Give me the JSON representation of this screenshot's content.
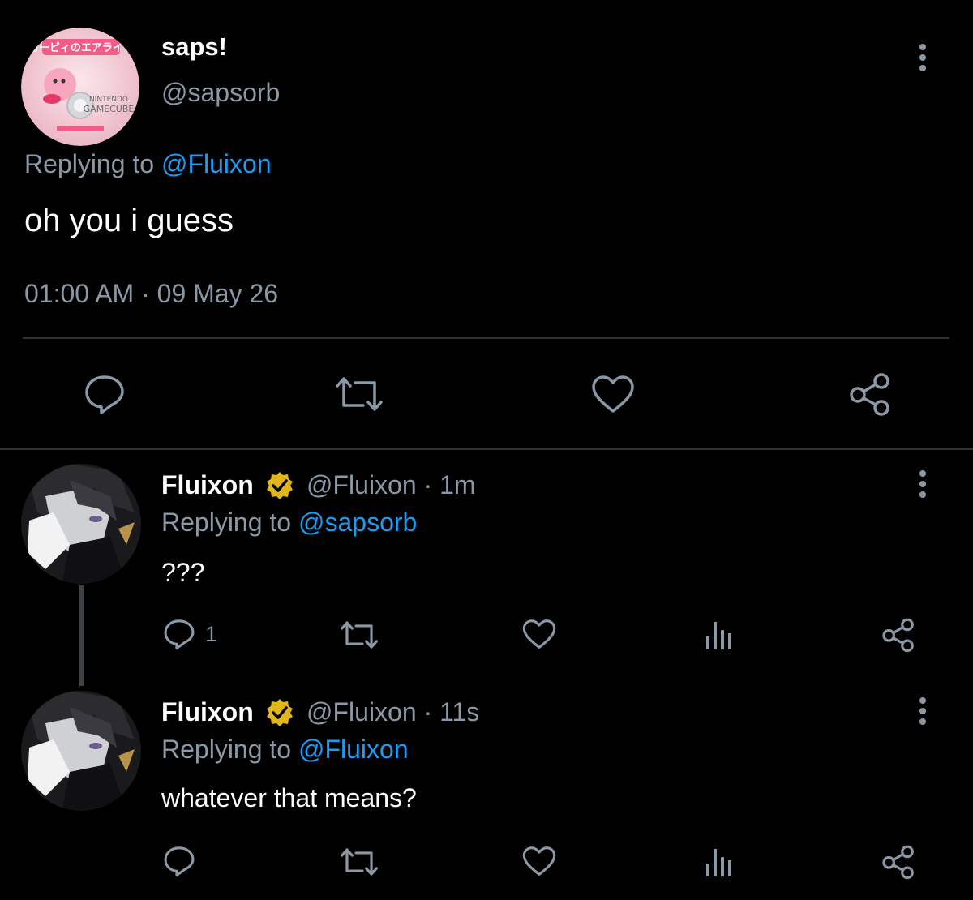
{
  "main_tweet": {
    "display_name": "saps!",
    "handle": "@sapsorb",
    "replying_prefix": "Replying to ",
    "replying_to": "@Fluixon",
    "text": "oh you i guess",
    "timestamp": "01:00 AM · 09 May 26",
    "actions": [
      "reply-icon",
      "retweet-icon",
      "like-icon",
      "share-icon"
    ]
  },
  "replies": [
    {
      "display_name": "Fluixon",
      "handle": "@Fluixon",
      "time": "· 1m",
      "replying_prefix": "Replying to ",
      "replying_to": "@sapsorb",
      "text": "???",
      "reply_count": "1",
      "actions": [
        "reply-icon",
        "retweet-icon",
        "like-icon",
        "analytics-icon",
        "share-icon"
      ]
    },
    {
      "display_name": "Fluixon",
      "handle": "@Fluixon",
      "time": "· 11s",
      "replying_prefix": "Replying to ",
      "replying_to": "@Fluixon",
      "text": "whatever that means?",
      "reply_count": "",
      "actions": [
        "reply-icon",
        "retweet-icon",
        "like-icon",
        "analytics-icon",
        "share-icon"
      ]
    }
  ],
  "colors": {
    "background": "#000000",
    "text_primary": "#e7e9ea",
    "text_secondary": "#8b98a5",
    "link": "#1d9bf0",
    "verified_badge": "#e2b719",
    "divider": "#2f3336"
  },
  "avatar_logo_text": {
    "top_text": "カービィのエアライド",
    "brand_1": "NINTENDO",
    "brand_2": "GAMECUBE"
  }
}
